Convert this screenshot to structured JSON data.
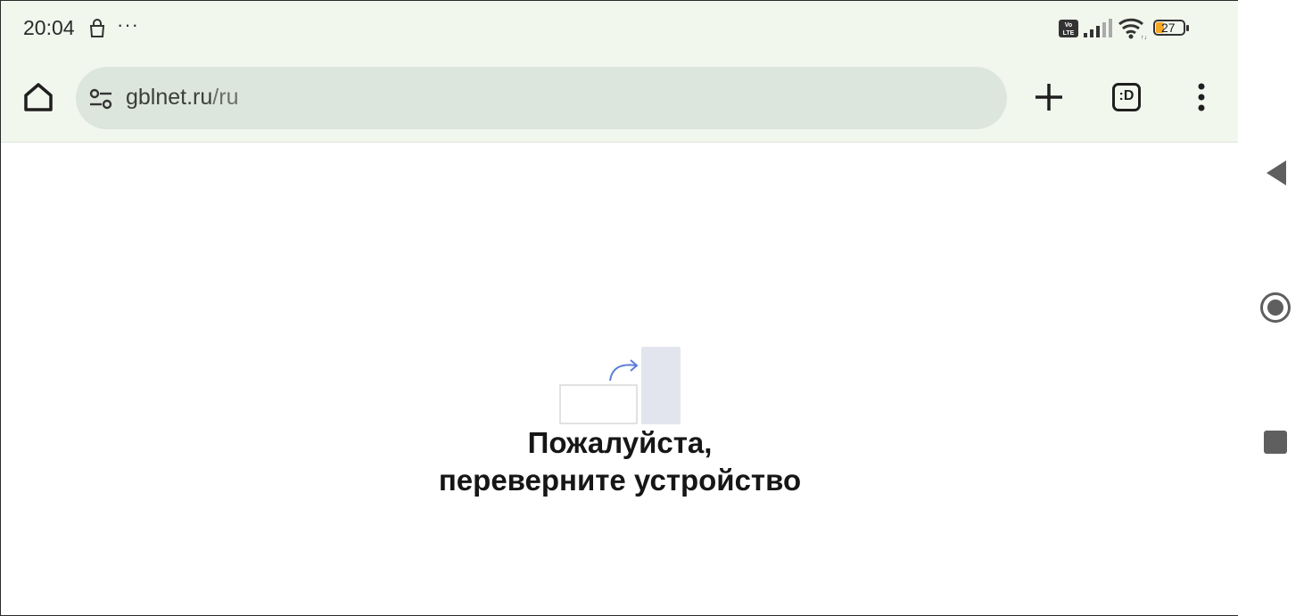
{
  "status_bar": {
    "time": "20:04",
    "overflow_dots": "···",
    "icons": [
      "shopping-bag-icon",
      "volte-icon",
      "signal-icon",
      "wifi-icon",
      "battery-icon"
    ],
    "battery_level": "27",
    "battery_color": "#f5a623"
  },
  "browser": {
    "url_host": "gblnet.ru",
    "url_path": "/ru",
    "tab_count_label": ":D",
    "icons": [
      "home-icon",
      "site-settings-icon",
      "new-tab-icon",
      "tab-switcher-icon",
      "more-vert-icon"
    ]
  },
  "page": {
    "message_line1": "Пожалуйста,",
    "message_line2": "переверните устройство",
    "arrow_color": "#5b7fd6"
  },
  "nav_bar": {
    "icons": [
      "back-icon",
      "home-circle-icon",
      "recents-icon"
    ]
  },
  "colors": {
    "chrome_bg": "#f2f7ee",
    "omnibox_bg": "#dde6dc"
  }
}
